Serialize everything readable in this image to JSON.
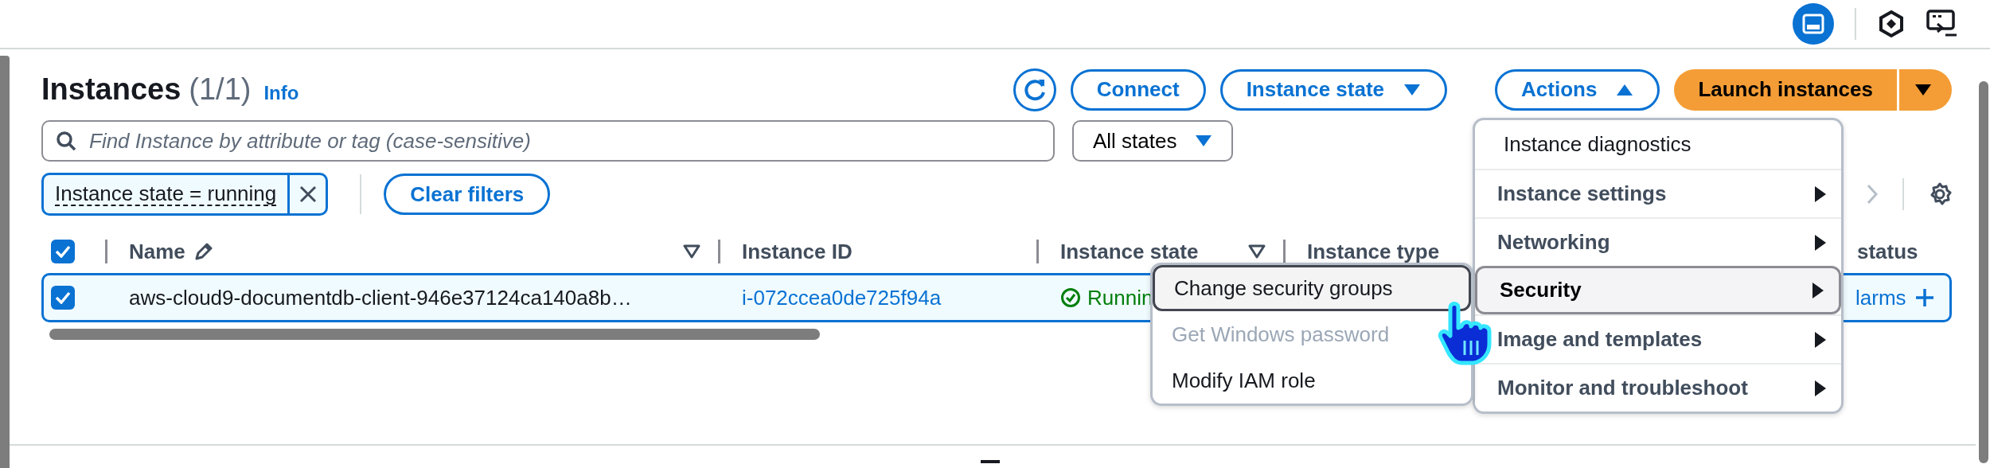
{
  "header": {
    "title": "Instances",
    "count": "(1/1)",
    "info": "Info"
  },
  "toolbar": [
    {
      "kind": "refresh"
    },
    {
      "kind": "plain",
      "label": "Connect"
    },
    {
      "kind": "dropdown",
      "label": "Instance state",
      "expanded": false
    },
    {
      "kind": "dropdown",
      "label": "Actions",
      "expanded": true
    },
    {
      "kind": "split",
      "label": "Launch instances"
    }
  ],
  "search": {
    "placeholder": "Find Instance by attribute or tag (case-sensitive)"
  },
  "state_filter": {
    "value": "All states"
  },
  "filter_token": {
    "label": "Instance state = running"
  },
  "clear_filters": "Clear filters",
  "table": {
    "select_all": {
      "checked": true
    },
    "columns": [
      {
        "label": "Name",
        "editable": true,
        "filter": true
      },
      {
        "label": "Instance ID"
      },
      {
        "label": "Instance state",
        "filter": true
      },
      {
        "label": "Instance type"
      },
      {
        "label": "status"
      }
    ],
    "rows": [
      {
        "selected": true,
        "name": "aws-cloud9-documentdb-client-946e37124ca140a8b…",
        "instance_id": "i-072ccea0de725f94a",
        "state": "Runnin",
        "column_5": "larms"
      }
    ]
  },
  "actions_menu": [
    {
      "kind": "item",
      "label": "Instance diagnostics",
      "selected": false
    },
    {
      "kind": "submenu",
      "label": "Instance settings",
      "selected": false
    },
    {
      "kind": "submenu",
      "label": "Networking",
      "selected": false
    },
    {
      "kind": "submenu",
      "label": "Security",
      "selected": true
    },
    {
      "kind": "submenu",
      "label": "Image and templates",
      "selected": false
    },
    {
      "kind": "submenu",
      "label": "Monitor and troubleshoot",
      "selected": false
    }
  ],
  "security_menu": [
    {
      "label": "Change security groups",
      "selected": true,
      "disabled": false
    },
    {
      "label": "Get Windows password",
      "selected": false,
      "disabled": true
    },
    {
      "label": "Modify IAM role",
      "selected": false,
      "disabled": false
    }
  ]
}
